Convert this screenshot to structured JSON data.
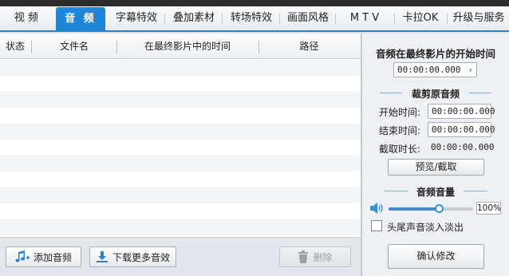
{
  "tabs": [
    {
      "label": "视  频",
      "active": false
    },
    {
      "label": "音 频",
      "active": true
    },
    {
      "label": "字幕特效",
      "active": false
    },
    {
      "label": "叠加素材",
      "active": false
    },
    {
      "label": "转场特效",
      "active": false
    },
    {
      "label": "画面风格",
      "active": false
    },
    {
      "label": "M T V",
      "active": false
    },
    {
      "label": "卡拉OK",
      "active": false
    },
    {
      "label": "升级与服务",
      "active": false
    }
  ],
  "list": {
    "columns": [
      "状态",
      "文件名",
      "在最终影片中的时间",
      "路径"
    ],
    "rows": []
  },
  "footer": {
    "add_audio": "添加音频",
    "download_more": "下载更多音效",
    "delete": "删除"
  },
  "right": {
    "start_title": "音频在最终影片的开始时间",
    "start_time": "00:00:00.000",
    "crop_title": "裁剪原音频",
    "start_label": "开始时间:",
    "start_value": "00:00:00.000",
    "end_label": "结束时间:",
    "end_value": "00:00:00.000",
    "duration_label": "截取时长:",
    "duration_value": "00:00:00.000",
    "preview_button": "预览/截取",
    "volume_title": "音频音量",
    "volume_percent": "100%",
    "volume_level": 0.6,
    "fade_label": "头尾声音淡入淡出",
    "fade_checked": false,
    "confirm_button": "确认修改"
  },
  "colors": {
    "accent": "#1f86d7",
    "topbar": "#2b2b2b"
  }
}
